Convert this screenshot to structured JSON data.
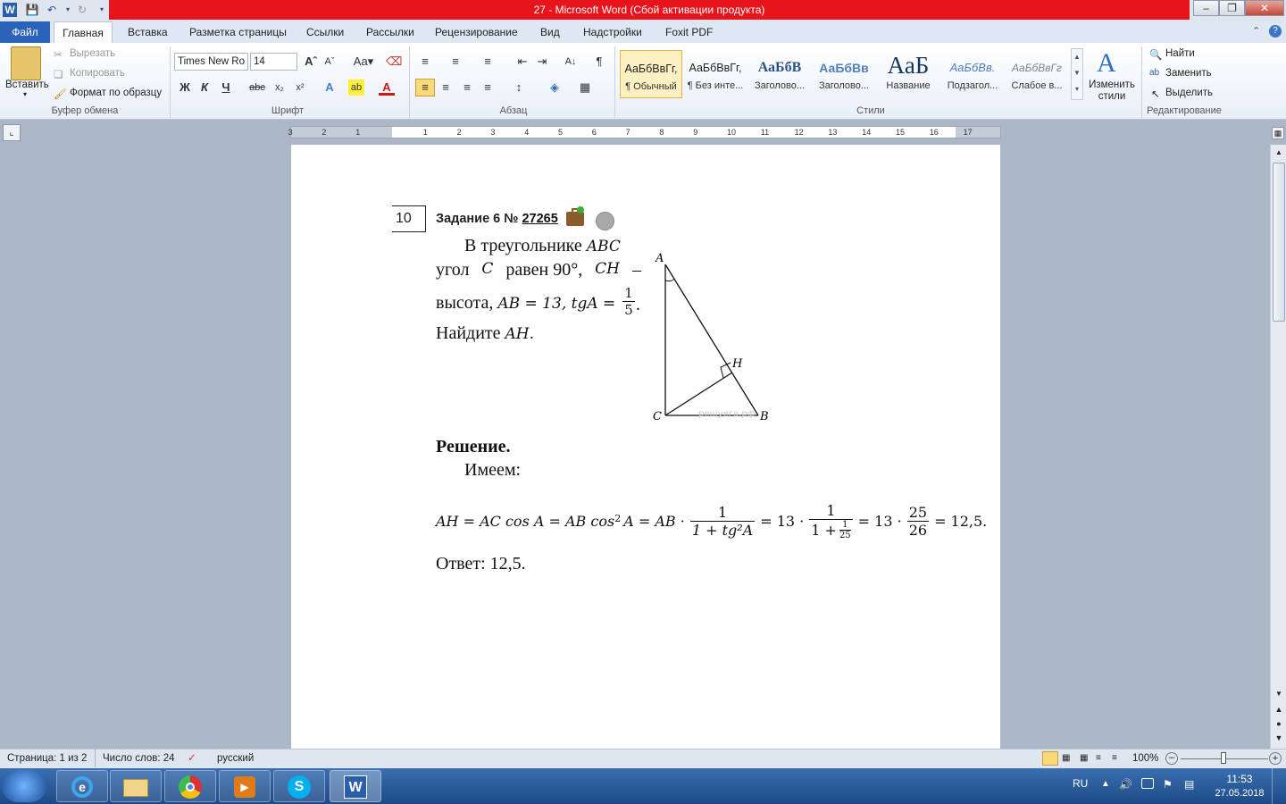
{
  "window": {
    "title": "27 - Microsoft Word (Сбой активации продукта)"
  },
  "tabs": [
    "Файл",
    "Главная",
    "Вставка",
    "Разметка страницы",
    "Ссылки",
    "Рассылки",
    "Рецензирование",
    "Вид",
    "Надстройки",
    "Foxit PDF"
  ],
  "ribbon": {
    "clipboard": {
      "paste": "Вставить",
      "cut": "Вырезать",
      "copy": "Копировать",
      "format_painter": "Формат по образцу",
      "label": "Буфер обмена"
    },
    "font": {
      "name": "Times New Ro",
      "size": "14",
      "label": "Шрифт"
    },
    "paragraph": {
      "label": "Абзац"
    },
    "styles": {
      "label": "Стили",
      "items": [
        {
          "preview": "АаБбВвГг,",
          "name": "¶ Обычный"
        },
        {
          "preview": "АаБбВвГг,",
          "name": "¶ Без инте..."
        },
        {
          "preview": "АаБбВ",
          "name": "Заголово..."
        },
        {
          "preview": "АаБбВв",
          "name": "Заголово..."
        },
        {
          "preview": "АаБ",
          "name": "Название"
        },
        {
          "preview": "АаБбВв.",
          "name": "Подзагол..."
        },
        {
          "preview": "АаБбВвГг",
          "name": "Слабое в..."
        }
      ],
      "change": "Изменить стили"
    },
    "editing": {
      "find": "Найти",
      "replace": "Заменить",
      "select": "Выделить",
      "label": "Редактирование"
    }
  },
  "ruler": {
    "ticks": [
      "3",
      "2",
      "1",
      "1",
      "2",
      "3",
      "4",
      "5",
      "6",
      "7",
      "8",
      "9",
      "10",
      "11",
      "12",
      "13",
      "14",
      "15",
      "16",
      "17"
    ]
  },
  "document": {
    "task_number": "10",
    "task_title": "Задание 6 №",
    "task_link": "27265",
    "problem": {
      "line1_text": "В треугольнике",
      "line1_math": "ABC",
      "line2_a": "угол",
      "line2_math1": "C",
      "line2_b": "равен 90°,",
      "line2_math2": "CH",
      "line2_c": "–",
      "line3_a": "высота,",
      "line3_math": "AB = 13,  tgA =",
      "frac_num": "1",
      "frac_den": "5",
      "line4_a": "Найдите",
      "line4_math": "AH."
    },
    "figure": {
      "label_A": "A",
      "label_B": "B",
      "label_C": "C",
      "label_H": "H",
      "watermark": "решуега.рф"
    },
    "solution_title": "Решение.",
    "solution_intro": "Имеем:",
    "formula": {
      "lhs": "AH = AC cos A = AB cos",
      "sup": "2",
      "mid": "A = AB ·",
      "f1_num": "1",
      "f1_den": "1 + tg²A",
      "eq2": "= 13 ·",
      "f2_num": "1",
      "f2_den_a": "1 +",
      "f2_den_num": "1",
      "f2_den_den": "25",
      "eq3": "= 13 ·",
      "f3_num": "25",
      "f3_den": "26",
      "result": "= 12,5."
    },
    "answer": "Ответ: 12,5."
  },
  "statusbar": {
    "page": "Страница: 1 из 2",
    "words": "Число слов: 24",
    "lang": "русский",
    "zoom": "100%"
  },
  "taskbar": {
    "lang": "RU",
    "time": "11:53",
    "date": "27.05.2018"
  }
}
